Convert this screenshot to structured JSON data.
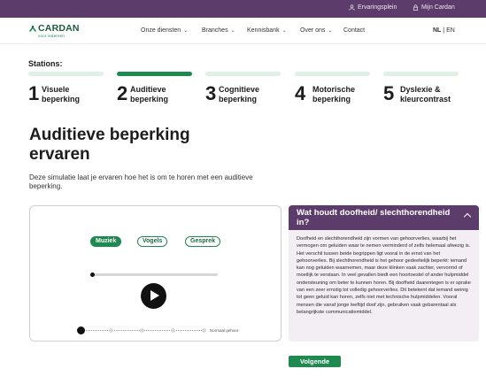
{
  "topbar": {
    "ervaringsplein": "Ervaringsplein",
    "mijn_cardan": "Mijn Cardan",
    "background": "#5c3c6a"
  },
  "logo": {
    "name": "CARDAN",
    "tagline": "voor iedereen"
  },
  "nav": {
    "items": [
      {
        "label": "Onze diensten",
        "has_dropdown": true
      },
      {
        "label": "Branches",
        "has_dropdown": true
      },
      {
        "label": "Kennisbank",
        "has_dropdown": true
      },
      {
        "label": "Over ons",
        "has_dropdown": true
      },
      {
        "label": "Contact",
        "has_dropdown": false
      }
    ],
    "lang_active": "NL",
    "lang_separator": "|",
    "lang_other": "EN"
  },
  "stations": {
    "label": "Stations:",
    "items": [
      {
        "num": "1",
        "label": "Visuele beperking",
        "active": false
      },
      {
        "num": "2",
        "label": "Auditieve beperking",
        "active": true
      },
      {
        "num": "3",
        "label": "Cognitieve beperking",
        "active": false
      },
      {
        "num": "4",
        "label": "Motorische beperking",
        "active": false
      },
      {
        "num": "5",
        "label": "Dyslexie & kleurcontrast",
        "active": false
      }
    ]
  },
  "main": {
    "title": "Auditieve beperking ervaren",
    "intro": "Deze simulatie laat je ervaren hoe het is om te horen met een auditieve beperking."
  },
  "player": {
    "chips": [
      {
        "label": "Muziek",
        "selected": true
      },
      {
        "label": "Vogels",
        "selected": false
      },
      {
        "label": "Gesprek",
        "selected": false
      }
    ],
    "slider_label": "Normaal gehoor",
    "progress": 0
  },
  "panel": {
    "title": "Wat houdt doofheid/ slechthorendheid in?",
    "body": "Doofheid en slechthorendheid zijn vormen van gehoorverlies, waarbij het vermogen om geluiden waar te nemen verminderd of zelfs helemaal afwezig is. Het verschil tussen beide begrippen ligt vooral in de ernst van het gehoorverlies. Bij slechthorendheid is het gehoor gedeeltelijk beperkt: iemand kan nog geluiden waarnemen, maar deze klinken vaak zachter, vervormd of moeilijk te verstaan. In veel gevallen biedt een hoortoestel of ander hulpmiddel ondersteuning om beter te kunnen horen. Bij doofheid daarentegen is er sprake van een zeer ernstig tot volledig gehoorverlies. Dit betekent dat iemand weinig tot geen geluid kan horen, zelfs niet met technische hulpmiddelen. Vooral mensen die vanaf jonge leeftijd doof zijn, gebruiken vaak gebarentaal als belangrijkste communicatiemiddel."
  },
  "actions": {
    "next": "Volgende"
  },
  "colors": {
    "brand_green": "#1e8a4f",
    "brand_purple": "#5c3c6a",
    "panel_bg": "#f2eef3"
  }
}
